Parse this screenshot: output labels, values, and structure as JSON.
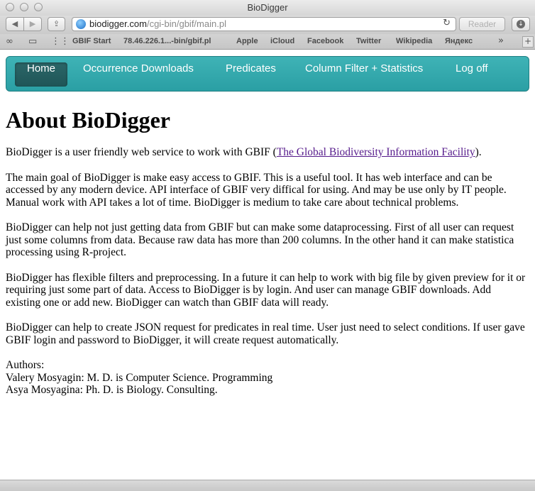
{
  "window": {
    "title": "BioDigger"
  },
  "toolbar": {
    "back_label": "◀",
    "forward_label": "▶",
    "share_label": "⇪",
    "url_host": "biodigger.com",
    "url_path": "/cgi-bin/gbif/main.pl",
    "reload_label": "↻",
    "reader_label": "Reader"
  },
  "bookmarks": {
    "items": [
      {
        "label": "GBIF Start"
      },
      {
        "label": "78.46.226.1...-bin/gbif.pl"
      },
      {
        "label": "Apple"
      },
      {
        "label": "iCloud"
      },
      {
        "label": "Facebook"
      },
      {
        "label": "Twitter"
      },
      {
        "label": "Wikipedia"
      },
      {
        "label": "Яндекс"
      }
    ],
    "more_label": "»",
    "plus_label": "+"
  },
  "nav": {
    "items": [
      {
        "label": "Home",
        "active": true
      },
      {
        "label": "Occurrence Downloads"
      },
      {
        "label": "Predicates"
      },
      {
        "label": "Column Filter + Statistics"
      },
      {
        "label": "Log off"
      }
    ]
  },
  "content": {
    "heading": "About BioDigger",
    "intro_before": "BioDigger is a user friendly web service to work with GBIF (",
    "intro_link": "The Global Biodiversity Information Facility",
    "intro_after": ").",
    "paragraphs": [
      "The main goal of BioDigger is make easy access to GBIF. This is a useful tool. It has web interface and can be accessed by any modern device. API interface of GBIF very diffical for using. And may be use only by IT people. Manual work with API takes a lot of time. BioDigger is medium to take care about technical problems.",
      "BioDigger can help not just getting data from GBIF but can make some dataprocessing. First of all user can request just some columns from data. Because raw data has more than 200 columns. In the other hand it can make statistica processing using R-project.",
      "BioDigger has flexible filters and preprocessing. In a future it can help to work with big file by given preview for it or requiring just some part of data. Access to BioDigger is by login. And user can manage GBIF downloads. Add existing one or add new. BioDigger can watch than GBIF data will ready.",
      "BioDigger can help to create JSON request for predicates in real time. User just need to select conditions. If user gave GBIF login and password to BioDigger, it will create request automatically."
    ],
    "authors_label": "Authors:",
    "authors": [
      "Valery Mosyagin: M. D. is Computer Science. Programming",
      "Asya Mosyagina: Ph. D. is Biology. Consulting."
    ]
  }
}
